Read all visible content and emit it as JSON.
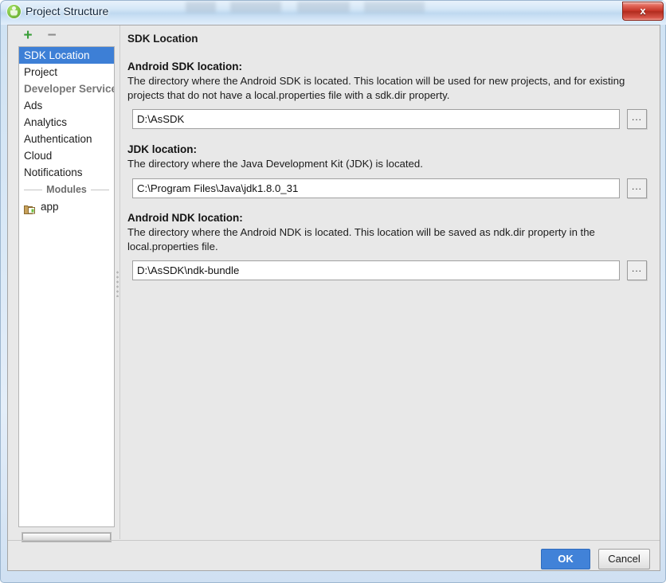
{
  "window": {
    "title": "Project Structure",
    "app_icon": "android-studio-icon",
    "close_label": "x",
    "accent_blue": "#3d7fd6",
    "ok_blue": "#4182d8",
    "background": "#e8e8e8"
  },
  "sidebar": {
    "toolbar": {
      "add_label": "+",
      "remove_label": "−"
    },
    "items": [
      {
        "label": "SDK Location",
        "type": "item",
        "selected": true
      },
      {
        "label": "Project",
        "type": "item",
        "selected": false
      },
      {
        "label": "Developer Services",
        "type": "group",
        "selected": false
      },
      {
        "label": "Ads",
        "type": "item",
        "selected": false
      },
      {
        "label": "Analytics",
        "type": "item",
        "selected": false
      },
      {
        "label": "Authentication",
        "type": "item",
        "selected": false
      },
      {
        "label": "Cloud",
        "type": "item",
        "selected": false
      },
      {
        "label": "Notifications",
        "type": "item",
        "selected": false
      }
    ],
    "separator_label": "Modules",
    "modules": [
      {
        "label": "app",
        "icon": "module-folder-icon"
      }
    ]
  },
  "content": {
    "page_title": "SDK Location",
    "sections": [
      {
        "label": "Android SDK location:",
        "description": "The directory where the Android SDK is located. This location will be used for new projects, and for existing projects that do not have a local.properties file with a sdk.dir property.",
        "value": "D:\\AsSDK",
        "placeholder": "",
        "browse_label": "..."
      },
      {
        "label": "JDK location:",
        "description": "The directory where the Java Development Kit (JDK) is located.",
        "value": "C:\\Program Files\\Java\\jdk1.8.0_31",
        "placeholder": "",
        "browse_label": "..."
      },
      {
        "label": "Android NDK location:",
        "description": "The directory where the Android NDK is located. This location will be saved as ndk.dir property in the local.properties file.",
        "value": "D:\\AsSDK\\ndk-bundle",
        "placeholder": "",
        "browse_label": "..."
      }
    ]
  },
  "footer": {
    "ok_label": "OK",
    "cancel_label": "Cancel"
  }
}
